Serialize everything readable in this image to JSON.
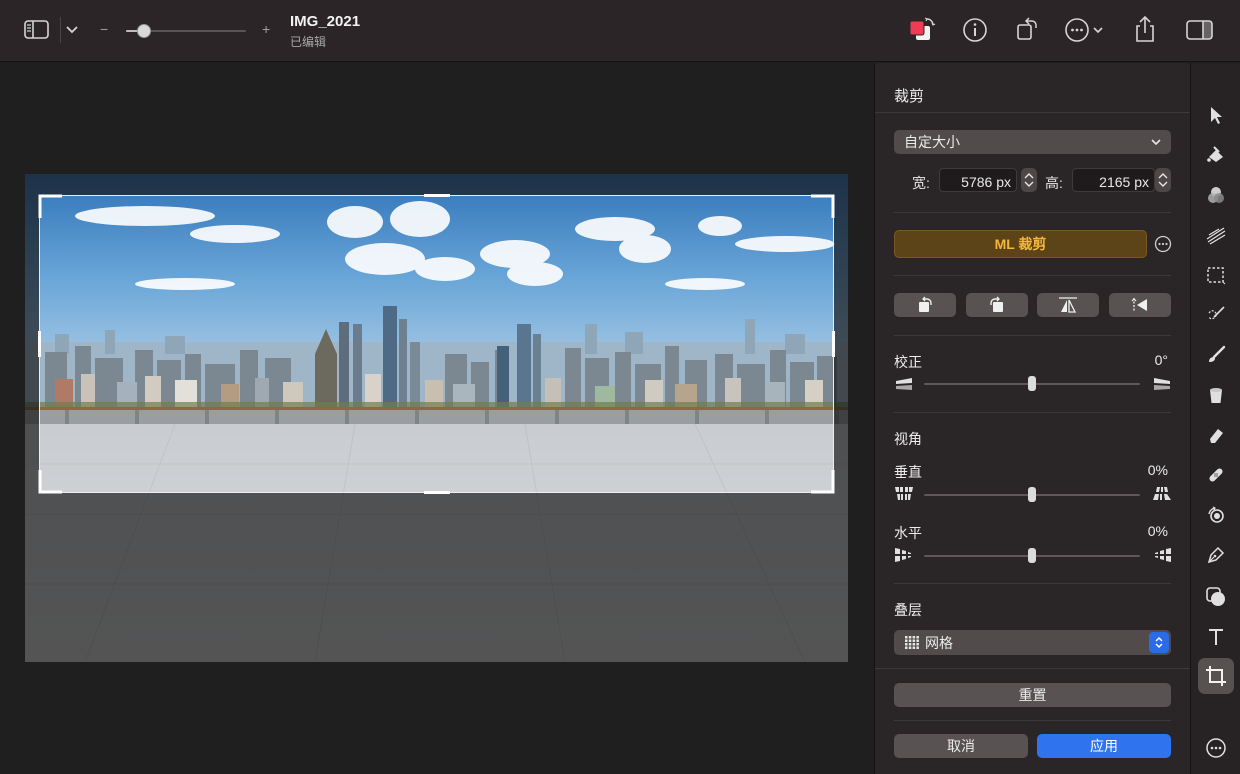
{
  "titlebar": {
    "title": "IMG_2021",
    "subtitle": "已编辑",
    "zoom_minus": "−",
    "zoom_plus": "+",
    "zoom_level": 0.15
  },
  "panel": {
    "title": "裁剪",
    "size_preset": "自定大小",
    "width_label": "宽:",
    "width_value": "5786 px",
    "height_label": "高:",
    "height_value": "2165 px",
    "ml_crop_label": "ML 裁剪",
    "straighten": {
      "label": "校正",
      "value": "0°",
      "level": 0.5
    },
    "perspective": {
      "label": "视角"
    },
    "vertical": {
      "label": "垂直",
      "value": "0%",
      "level": 0.5
    },
    "horizontal": {
      "label": "水平",
      "value": "0%",
      "level": 0.5
    },
    "overlay": {
      "label": "叠层",
      "value": "网格"
    },
    "reset_label": "重置",
    "cancel_label": "取消",
    "apply_label": "应用"
  },
  "colors": {
    "accent_blue": "#2f73ee",
    "ml_gold": "#f5b73b",
    "swatch_red": "#ef3b56"
  },
  "tools": [
    "arrow-select-icon",
    "paint-fill-icon",
    "color-adjust-icon",
    "smudge-icon",
    "rect-select-icon",
    "magic-wand-icon",
    "brush-icon",
    "bucket-icon",
    "eraser-icon",
    "retouch-bandage-icon",
    "clone-icon",
    "pen-icon",
    "shape-icon",
    "text-icon",
    "crop-icon"
  ]
}
